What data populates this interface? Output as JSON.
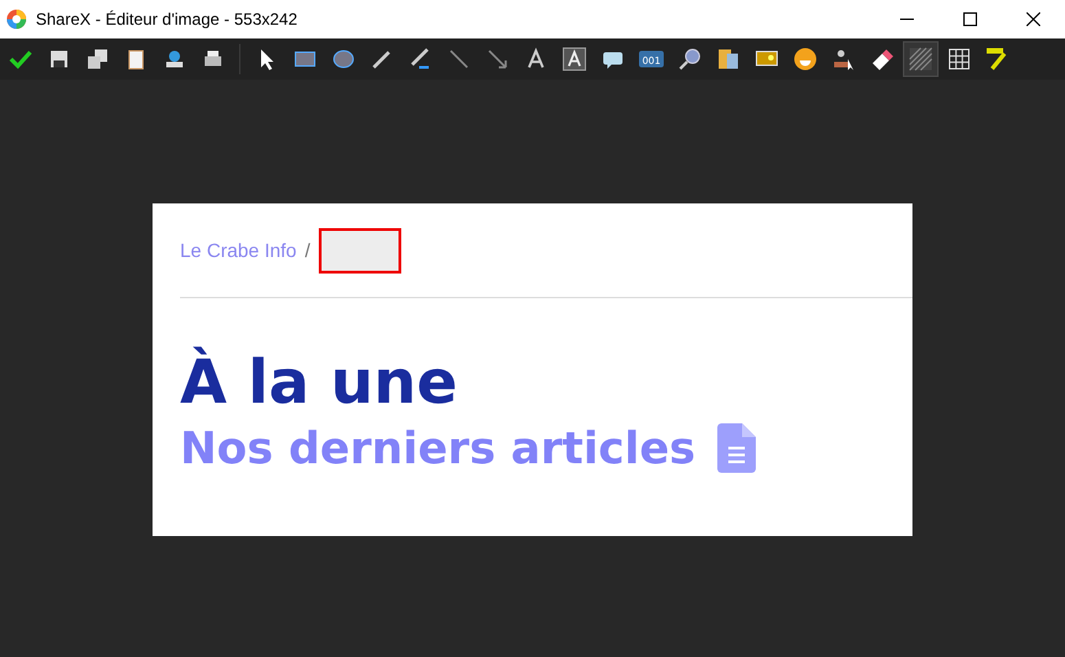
{
  "window": {
    "title": "ShareX - Éditeur d'image - 553x242"
  },
  "toolbar": {
    "file_tools": [
      {
        "kind": "confirm"
      },
      {
        "kind": "save"
      },
      {
        "kind": "save-as"
      },
      {
        "kind": "clipboard"
      },
      {
        "kind": "upload"
      },
      {
        "kind": "print"
      }
    ],
    "tools": [
      {
        "kind": "pointer",
        "selected": false
      },
      {
        "kind": "rectangle",
        "selected": false
      },
      {
        "kind": "ellipse",
        "selected": false
      },
      {
        "kind": "pen",
        "selected": false
      },
      {
        "kind": "pen-back",
        "selected": false
      },
      {
        "kind": "line",
        "selected": false
      },
      {
        "kind": "arrow",
        "selected": false
      },
      {
        "kind": "text",
        "selected": false
      },
      {
        "kind": "text-box",
        "selected": false
      },
      {
        "kind": "speech",
        "selected": false
      },
      {
        "kind": "counter",
        "selected": false
      },
      {
        "kind": "magnifier",
        "selected": false
      },
      {
        "kind": "files",
        "selected": false
      },
      {
        "kind": "picture",
        "selected": false
      },
      {
        "kind": "emoji",
        "selected": false
      },
      {
        "kind": "cursor",
        "selected": false
      },
      {
        "kind": "eraser",
        "selected": false
      },
      {
        "kind": "hatch",
        "selected": true
      },
      {
        "kind": "grid",
        "selected": false
      },
      {
        "kind": "highlighter",
        "selected": false
      }
    ],
    "counter_label": "001"
  },
  "image": {
    "breadcrumb": {
      "site": "Le Crabe Info",
      "separator": "/"
    },
    "heading": "À la une",
    "subheading": "Nos derniers articles"
  }
}
